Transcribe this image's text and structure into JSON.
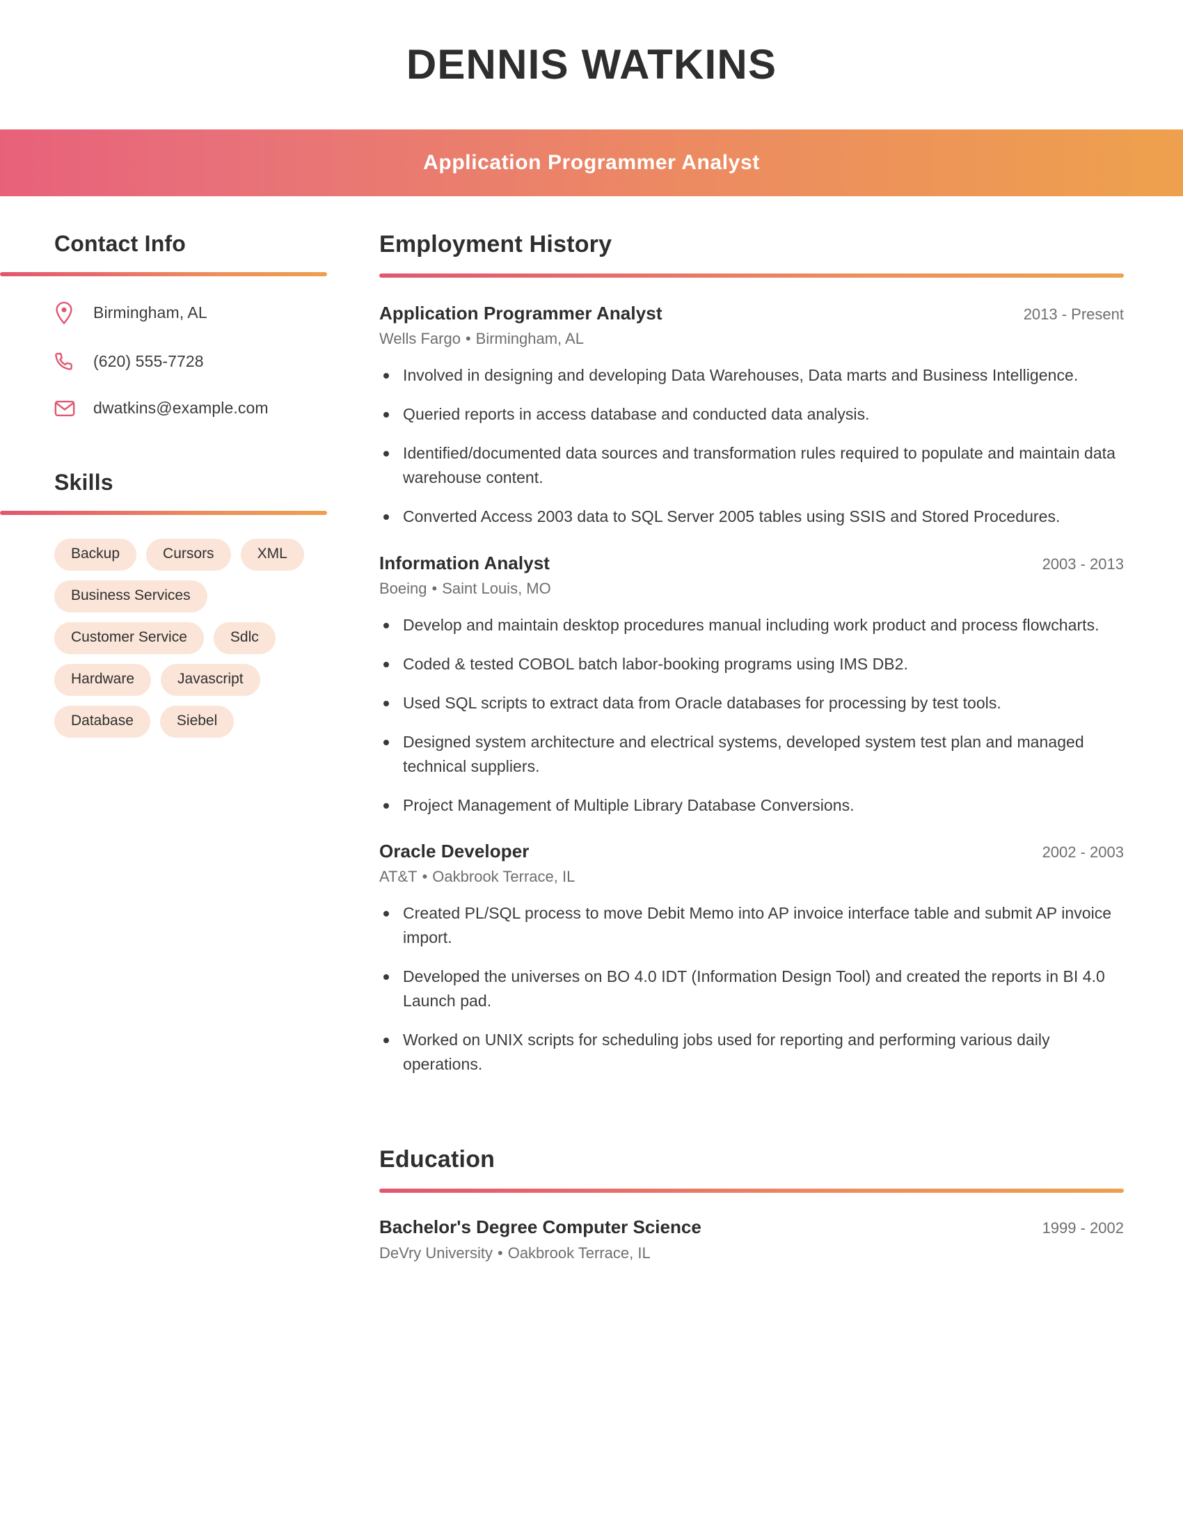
{
  "header": {
    "name": "Dennis Watkins",
    "subtitle": "Application Programmer Analyst",
    "bar_gradient_start": "#e8617a",
    "bar_gradient_end": "#eea14d"
  },
  "theme": {
    "accent_pink": "#e2566f",
    "accent_orange": "#eda04f",
    "pill_bg": "#fbe5d8",
    "icon_color": "#e0576f"
  },
  "sidebar": {
    "contact": {
      "title": "Contact Info",
      "items": [
        {
          "icon": "location-pin-icon",
          "value": "Birmingham, AL"
        },
        {
          "icon": "phone-icon",
          "value": "(620) 555-7728"
        },
        {
          "icon": "envelope-icon",
          "value": "dwatkins@example.com"
        }
      ]
    },
    "skills": {
      "title": "Skills",
      "items": [
        "Backup",
        "Cursors",
        "XML",
        "Business Services",
        "Customer Service",
        "Sdlc",
        "Hardware",
        "Javascript",
        "Database",
        "Siebel"
      ]
    }
  },
  "main": {
    "employment": {
      "title": "Employment History",
      "jobs": [
        {
          "title": "Application Programmer Analyst",
          "dates": "2013 - Present",
          "company": "Wells Fargo",
          "location": "Birmingham, AL",
          "bullets": [
            "Involved in designing and developing Data Warehouses, Data marts and Business Intelligence.",
            "Queried reports in access database and conducted data analysis.",
            "Identified/documented data sources and transformation rules required to populate and maintain data warehouse content.",
            "Converted Access 2003 data to SQL Server 2005 tables using SSIS and Stored Procedures."
          ]
        },
        {
          "title": "Information Analyst",
          "dates": "2003 - 2013",
          "company": "Boeing",
          "location": "Saint Louis, MO",
          "bullets": [
            "Develop and maintain desktop procedures manual including work product and process flowcharts.",
            "Coded & tested COBOL batch labor-booking programs using IMS DB2.",
            "Used SQL scripts to extract data from Oracle databases for processing by test tools.",
            "Designed system architecture and electrical systems, developed system test plan and managed technical suppliers.",
            "Project Management of Multiple Library Database Conversions."
          ]
        },
        {
          "title": "Oracle Developer",
          "dates": "2002 - 2003",
          "company": "AT&T",
          "location": "Oakbrook Terrace, IL",
          "bullets": [
            "Created PL/SQL process to move Debit Memo into AP invoice interface table and submit AP invoice import.",
            "Developed the universes on BO 4.0 IDT (Information Design Tool) and created the reports in BI 4.0 Launch pad.",
            "Worked on UNIX scripts for scheduling jobs used for reporting and performing various daily operations."
          ]
        }
      ]
    },
    "education": {
      "title": "Education",
      "entries": [
        {
          "degree": "Bachelor's Degree Computer Science",
          "dates": "1999 - 2002",
          "school": "DeVry University",
          "location": "Oakbrook Terrace, IL"
        }
      ]
    }
  },
  "separator_dot": "•"
}
